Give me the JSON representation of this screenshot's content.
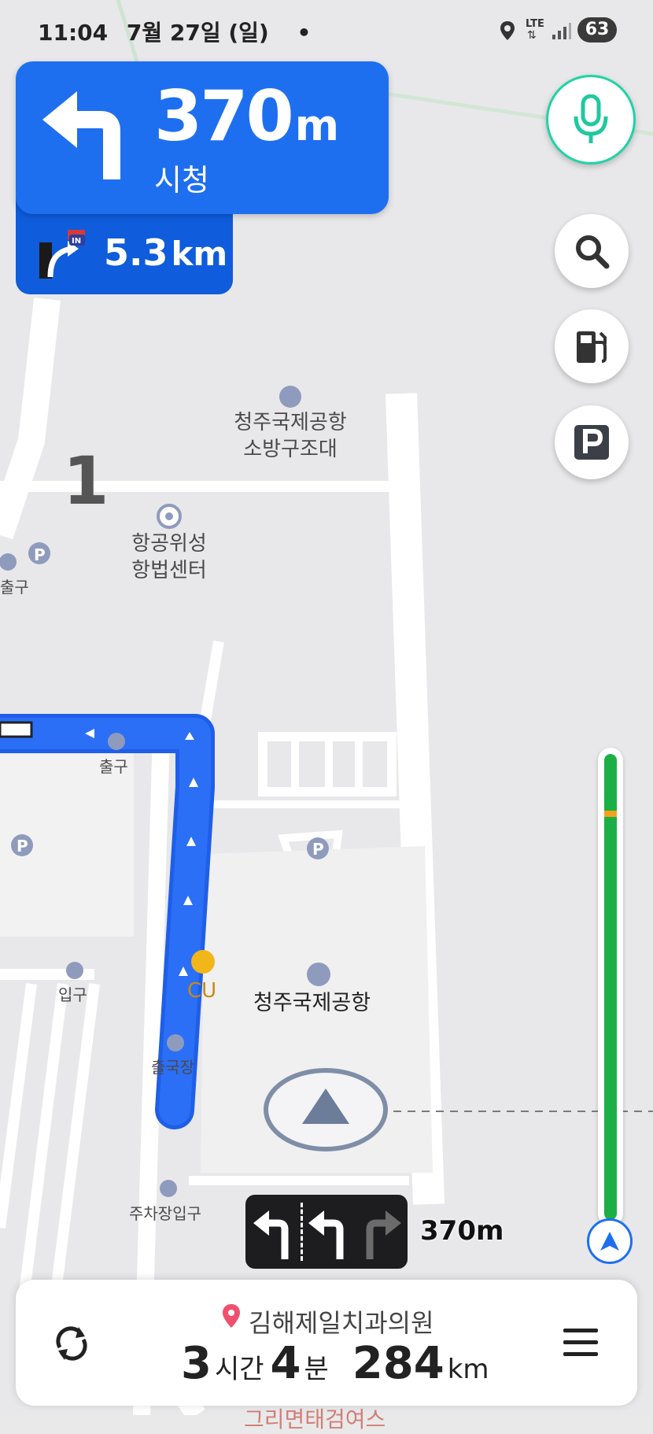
{
  "status_bar": {
    "time": "11:04",
    "date": "7월 27일 (일)",
    "network": "LTE",
    "battery": "63"
  },
  "guidance": {
    "turn_distance_value": "370",
    "turn_distance_unit": "m",
    "turn_direction_icon": "turn-left-arrow",
    "turn_street": "시청",
    "next_icon": "highway-entrance-icon",
    "next_badge": "IN",
    "next_distance_value": "5.3",
    "next_distance_unit": "km"
  },
  "map": {
    "zoom_marker": "1",
    "labels": {
      "fire_station": [
        "청주국제공항",
        "소방구조대"
      ],
      "satellite_center": [
        "항공위성",
        "항법센터"
      ],
      "exit_top": "출구",
      "exit_left": "출구",
      "entrance": "입구",
      "convenience_store": "CU",
      "departure": "출국장",
      "airport": "청주국제공항",
      "parking_entrance": "주차장입구"
    }
  },
  "lanes": {
    "lanes": [
      "left",
      "left",
      "right"
    ],
    "distance": "370m"
  },
  "traffic": {
    "colors": {
      "free": "#1ab046",
      "slow": "#f4a21b"
    }
  },
  "bottom": {
    "destination": "김해제일치과의원",
    "hours": "3",
    "hours_unit": "시간",
    "minutes": "4",
    "minutes_unit": "분",
    "distance": "284",
    "distance_unit": "km",
    "underlying_text": "그리면태검여스"
  },
  "colors": {
    "primary_blue": "#1e6ff0",
    "route_blue": "#1f5ee8",
    "voice_green": "#1fd3a5"
  }
}
